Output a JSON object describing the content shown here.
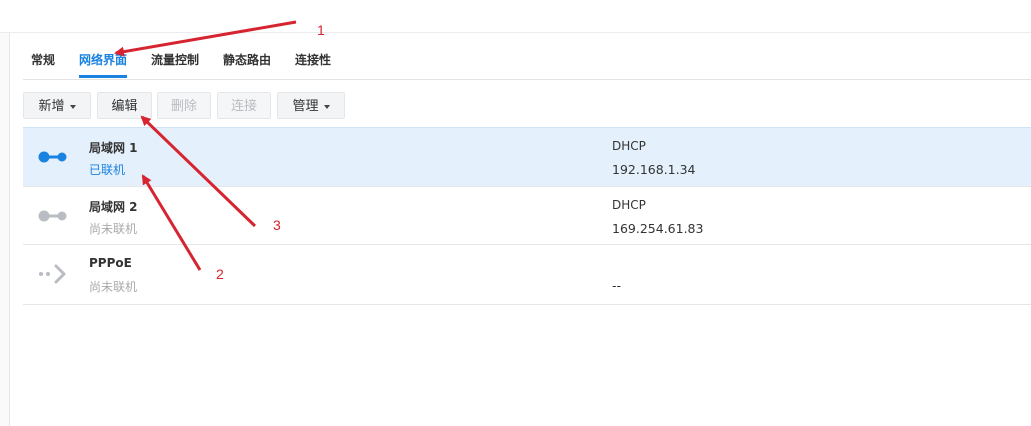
{
  "tabs": [
    {
      "label": "常规",
      "active": false
    },
    {
      "label": "网络界面",
      "active": true
    },
    {
      "label": "流量控制",
      "active": false
    },
    {
      "label": "静态路由",
      "active": false
    },
    {
      "label": "连接性",
      "active": false
    }
  ],
  "toolbar": {
    "create_label": "新增",
    "edit_label": "编辑",
    "delete_label": "删除",
    "connect_label": "连接",
    "manage_label": "管理"
  },
  "interfaces": [
    {
      "name": "局域网 1",
      "status": "已联机",
      "mode": "DHCP",
      "ip": "192.168.1.34",
      "icon": "ethernet-connected-icon",
      "selected": true
    },
    {
      "name": "局域网 2",
      "status": "尚未联机",
      "mode": "DHCP",
      "ip": "169.254.61.83",
      "icon": "ethernet-disconnected-icon",
      "selected": false
    },
    {
      "name": "PPPoE",
      "status": "尚未联机",
      "mode": "",
      "ip": "--",
      "icon": "pppoe-icon",
      "selected": false
    }
  ],
  "annotations": {
    "label_1": "1",
    "label_2": "2",
    "label_3": "3"
  },
  "colors": {
    "accent": "#1a82e0",
    "selected_row": "#e4f1fc",
    "annotation": "#d62430",
    "inactive_icon": "#b9bcc2"
  }
}
